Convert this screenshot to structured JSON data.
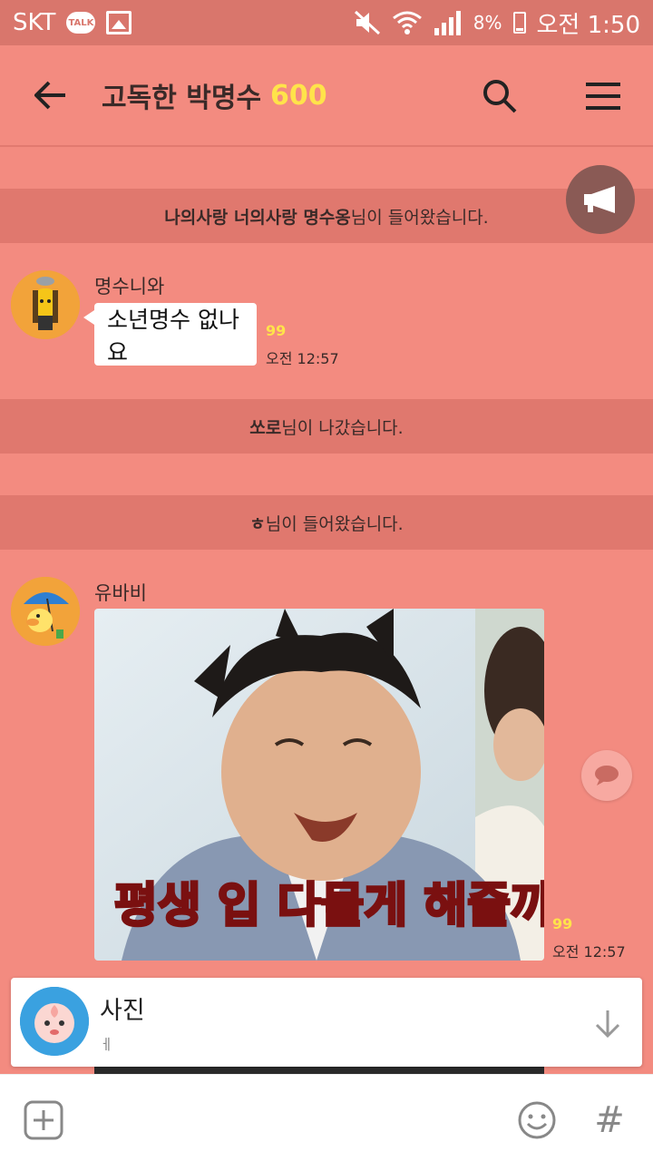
{
  "status_bar": {
    "carrier": "SKT",
    "talk_badge": "TALK",
    "battery": "8%",
    "time": "오전 1:50"
  },
  "header": {
    "title": "고독한 박명수",
    "member_count": "600",
    "accent_color": "#ffe34a",
    "background_color": "#f38b80"
  },
  "notices": [
    {
      "bold": "나의사랑 너의사랑 명수옹",
      "rest": "님이 들어왔습니다."
    },
    {
      "bold": "쏘로",
      "rest": "님이 나갔습니다."
    },
    {
      "bold": "ㅎ",
      "rest": "님이 들어왔습니다."
    }
  ],
  "messages": [
    {
      "sender": "명수니와",
      "text": "소년명수 없나요",
      "unread": "99",
      "time": "오전 12:57"
    },
    {
      "sender": "유바비",
      "photo_caption": "평생 입 다물게 해줄까?",
      "unread": "99",
      "time": "오전 12:57"
    }
  ],
  "preview": {
    "title": "사진",
    "subtitle": "ㅔ"
  },
  "icons": {
    "back": "arrow-left-icon",
    "search": "search-icon",
    "menu": "hamburger-menu-icon",
    "megaphone": "megaphone-icon",
    "reply": "speech-bubble-icon",
    "down": "arrow-down-icon",
    "plus": "plus-icon",
    "emoji": "emoji-icon",
    "hash": "#"
  }
}
